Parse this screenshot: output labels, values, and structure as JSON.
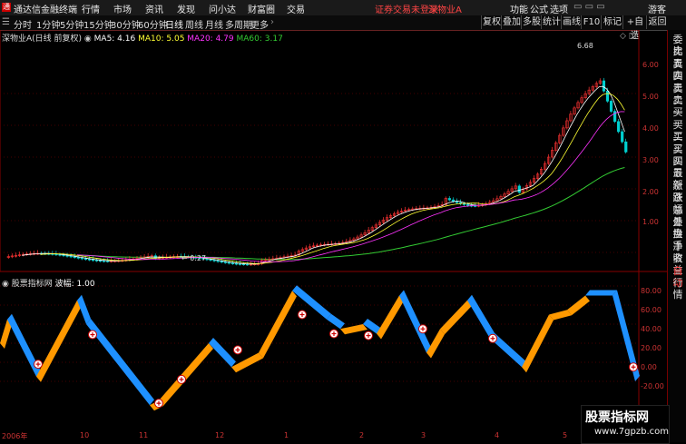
{
  "menu": {
    "app_title": "通达信金融终端",
    "items": [
      "行情",
      "市场",
      "资讯",
      "发现",
      "问小达",
      "财富圈",
      "交易"
    ],
    "status_login": "证券交易未登录",
    "stock_name": "深物业A",
    "right_items": [
      "功能",
      "公式",
      "选项"
    ],
    "guest": "游客"
  },
  "toolbar": {
    "periods": [
      "分时",
      "1分钟",
      "5分钟",
      "15分钟",
      "30分钟",
      "60分钟",
      "日线",
      "周线",
      "月线",
      "多周期",
      "更多"
    ],
    "active_period": "日线",
    "right_buttons": [
      "复权",
      "叠加",
      "多股",
      "统计",
      "画线",
      "F10",
      "标记",
      "+自选",
      "返回"
    ]
  },
  "main_chart": {
    "title": "深物业A(日线 前复权)",
    "ma": [
      {
        "label": "MA5: 4.16",
        "color": "#ffffff"
      },
      {
        "label": "MA10: 5.05",
        "color": "#ffff33"
      },
      {
        "label": "MA20: 4.79",
        "color": "#ff33ff"
      },
      {
        "label": "MA60: 3.17",
        "color": "#33cc33"
      }
    ],
    "price_ticks": [
      "6.00",
      "5.00",
      "4.00",
      "3.00",
      "2.00",
      "1.00"
    ],
    "high_label": "6.68",
    "low_label": "0.27"
  },
  "indicator": {
    "title": "股票指标网",
    "param": "波幅: 1.00",
    "ticks": [
      "80.00",
      "60.00",
      "40.00",
      "20.00",
      "0.00",
      "-20.00"
    ]
  },
  "x_axis": {
    "labels": [
      "2006年",
      "10",
      "11",
      "12",
      "1",
      "2",
      "3",
      "4",
      "5"
    ]
  },
  "right_panel": [
    {
      "t": "委比",
      "red": false
    },
    {
      "t": "卖五",
      "red": false
    },
    {
      "t": "卖四",
      "red": false
    },
    {
      "t": "卖三",
      "red": false
    },
    {
      "t": "卖二",
      "red": false
    },
    {
      "t": "卖一",
      "red": false
    },
    {
      "t": "买一",
      "red": false
    },
    {
      "t": "买二",
      "red": false
    },
    {
      "t": "买三",
      "red": false
    },
    {
      "t": "买四",
      "red": false
    },
    {
      "t": "买五",
      "red": false
    },
    {
      "t": "最新",
      "red": false
    },
    {
      "t": "涨跌",
      "red": false
    },
    {
      "t": "涨幅",
      "red": false
    },
    {
      "t": "总量",
      "red": false
    },
    {
      "t": "外盘",
      "red": false
    },
    {
      "t": "换手",
      "red": false
    },
    {
      "t": "净资",
      "red": false
    },
    {
      "t": "收益",
      "red": false
    },
    {
      "t": "自动",
      "red": true
    },
    {
      "t": "行情",
      "red": false
    }
  ],
  "watermark": {
    "title": "股票指标网",
    "url": "www.7gpzb.com"
  },
  "colors": {
    "up": "#ff3333",
    "down": "#00d0d0",
    "wave_up": "#ff9900",
    "wave_down": "#1e90ff"
  }
}
